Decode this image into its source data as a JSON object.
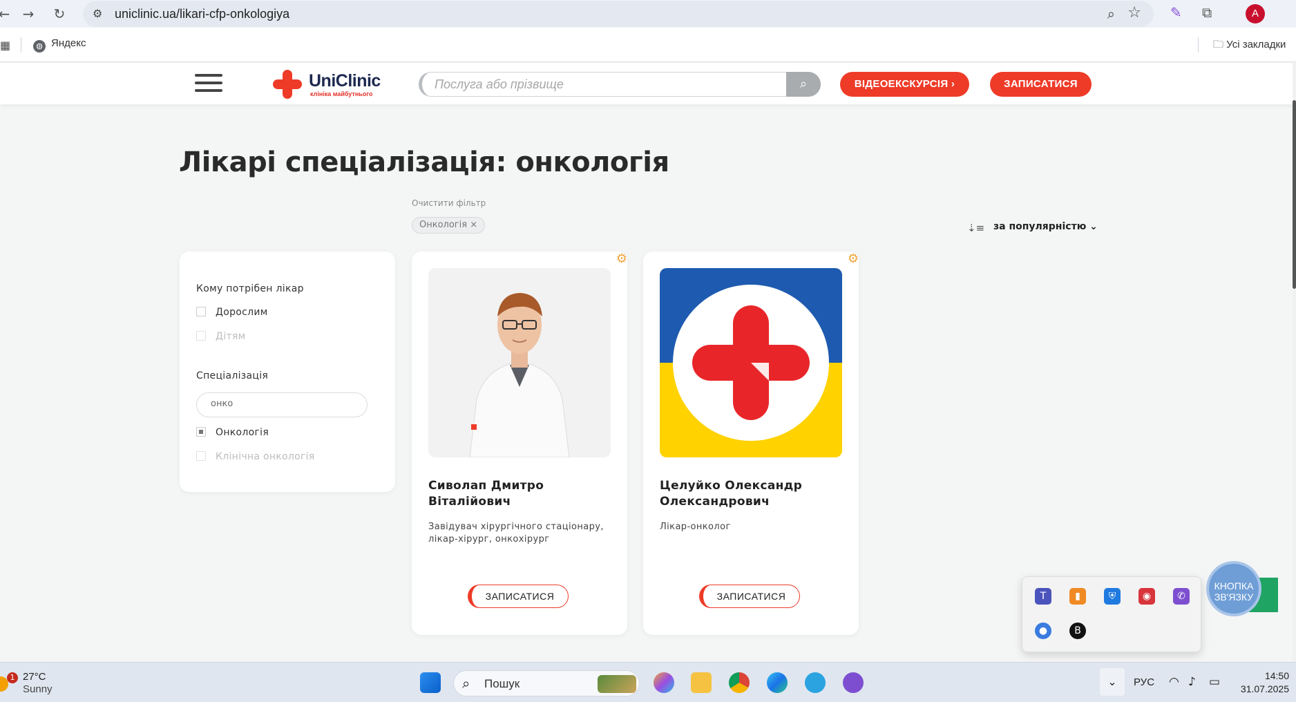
{
  "browser": {
    "url": "uniclinic.ua/likari-cfp-onkologiya",
    "bookmark_yandex": "Яндекс",
    "bookmark_all": "Усі закладки",
    "profile_initial": "A"
  },
  "header": {
    "brand_name": "UniClinic",
    "brand_tagline": "клініка майбутнього",
    "search_placeholder": "Послуга або прізвище",
    "video_tour_label": "ВІДЕОЕКСКУРСІЯ ›",
    "book_label": "ЗАПИСАТИСЯ",
    "accent_color": "#ee3b28"
  },
  "page": {
    "title": "Лікарі спеціалізація: онкологія",
    "clear_filter": "Очистити фільтр",
    "active_filter": "Онкологія ×",
    "sort_label": "за популярністю ⌄"
  },
  "filters": {
    "who_heading": "Кому потрібен лікар",
    "who_options": [
      {
        "label": "Дорослим",
        "checked": false,
        "disabled": false
      },
      {
        "label": "Дітям",
        "checked": false,
        "disabled": true
      }
    ],
    "spec_heading": "Спеціалізація",
    "spec_search_value": "онко",
    "spec_options": [
      {
        "label": "Онкологія",
        "checked": true,
        "disabled": false
      },
      {
        "label": "Клінічна онкологія",
        "checked": false,
        "disabled": true
      }
    ]
  },
  "doctors": [
    {
      "name": "Сиволап Дмитро Віталійович",
      "role": "Завідувач хірургічного стаціонару, лікар-хірург, онкохірург",
      "book_label": "ЗАПИСАТИСЯ",
      "photo": "doctor-portrait"
    },
    {
      "name": "Целуйко Олександр Олександрович",
      "role": "Лікар-онколог",
      "book_label": "ЗАПИСАТИСЯ",
      "photo": "uniclinic-logo-ukraine-flag"
    }
  ],
  "widget": {
    "contact_button": "КНОПКА ЗВ'ЯЗКУ"
  },
  "taskbar": {
    "temperature": "27°C",
    "weather": "Sunny",
    "weather_badge": "1",
    "search_label": "Пошук",
    "language": "РУС",
    "time": "14:50",
    "date": "31.07.2025"
  }
}
